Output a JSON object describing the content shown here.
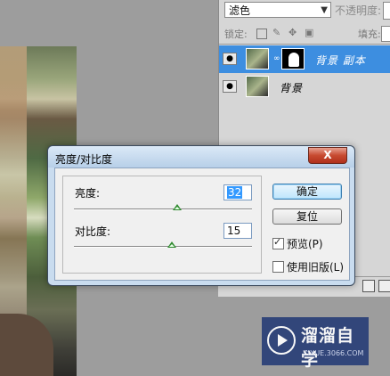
{
  "layers_panel": {
    "blend_mode": "滤色",
    "opacity_label": "不透明度:",
    "lock_label": "锁定:",
    "fill_label": "填充:",
    "layers": [
      {
        "name": "背景 副本",
        "selected": true,
        "has_mask": true
      },
      {
        "name": "背景",
        "selected": false,
        "has_mask": false
      }
    ]
  },
  "dialog": {
    "title": "亮度/对比度",
    "close_label": "X",
    "brightness": {
      "label": "亮度:",
      "value": "32",
      "slider_fraction": 0.58
    },
    "contrast": {
      "label": "对比度:",
      "value": "15",
      "slider_fraction": 0.55
    },
    "ok_label": "确定",
    "reset_label": "复位",
    "preview_label": "预览(P)",
    "preview_checked": true,
    "legacy_label": "使用旧版(L)",
    "legacy_checked": false
  },
  "watermark": {
    "title": "溜溜自学",
    "sub": "ZIXUE.3066.COM"
  },
  "colors": {
    "selected_layer": "#3d8ee0",
    "dialog_frame": "#c9dcef",
    "slider_thumb": "#2f8a2f"
  }
}
